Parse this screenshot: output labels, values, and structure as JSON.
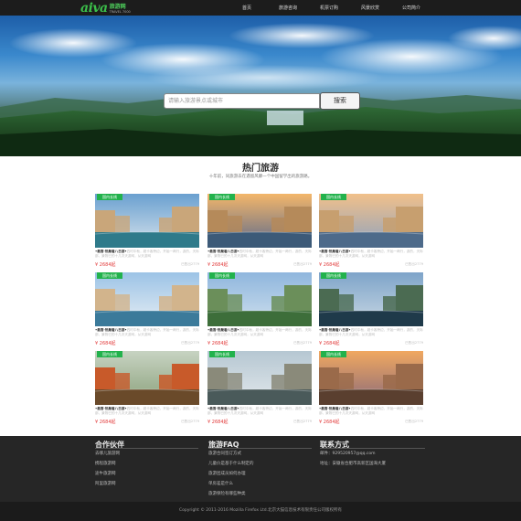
{
  "header": {
    "logo_mark": "aiva",
    "logo_cn": "旅游网",
    "logo_en": "TRAVEL 7000",
    "nav": [
      "首页",
      "旅游咨询",
      "机票订购",
      "风景欣赏",
      "公司简介"
    ]
  },
  "search": {
    "placeholder": "请输入旅游景点或城市",
    "button": "搜索"
  },
  "section": {
    "title": "热门旅游",
    "subtitle": "十年前，同旅游去在遇留风靡一个中国留学出的旅游路。"
  },
  "cards": [
    {
      "badge": "国内长线",
      "title": "•最香·热聚看八日游•",
      "desc": "四时中秋，超卡客旁边，开始一两行，游的，天际部，景物已的十几次天游网，从天游网",
      "price": "¥ 2684起",
      "sold": "已售出2779"
    },
    {
      "badge": "国内长线",
      "title": "•最香·热聚看八日游•",
      "desc": "四时中秋，超卡客旁边，开始一两行，游的，天际部，景物已的十几次天游网，从天游网",
      "price": "¥ 2684起",
      "sold": "已售出2779"
    },
    {
      "badge": "国内长线",
      "title": "•最香·热聚看八日游•",
      "desc": "四时中秋，超卡客旁边，开始一两行，游的，天际部，景物已的十几次天游网，从天游网",
      "price": "¥ 2684起",
      "sold": "已售出2779"
    },
    {
      "badge": "国内长线",
      "title": "•最香·热聚看八日游•",
      "desc": "四时中秋，超卡客旁边，开始一两行，游的，天际部，景物已的十几次天游网，从天游网",
      "price": "¥ 2684起",
      "sold": "已售出2779"
    },
    {
      "badge": "国内长线",
      "title": "•最香·热聚看八日游•",
      "desc": "四时中秋，超卡客旁边，开始一两行，游的，天际部，景物已的十几次天游网，从天游网",
      "price": "¥ 2684起",
      "sold": "已售出2779"
    },
    {
      "badge": "国内长线",
      "title": "•最香·热聚看八日游•",
      "desc": "四时中秋，超卡客旁边，开始一两行，游的，天际部，景物已的十几次天游网，从天游网",
      "price": "¥ 2684起",
      "sold": "已售出2779"
    },
    {
      "badge": "国内长线",
      "title": "•最香·热聚看八日游•",
      "desc": "四时中秋，超卡客旁边，开始一两行，游的，天际部，景物已的十几次天游网，从天游网",
      "price": "¥ 2684起",
      "sold": "已售出2779"
    },
    {
      "badge": "国内长线",
      "title": "•最香·热聚看八日游•",
      "desc": "四时中秋，超卡客旁边，开始一两行，游的，天际部，景物已的十几次天游网，从天游网",
      "price": "¥ 2684起",
      "sold": "已售出2779"
    },
    {
      "badge": "国内长线",
      "title": "•最香·热聚看八日游•",
      "desc": "四时中秋，超卡客旁边，开始一两行，游的，天际部，景物已的十几次天游网，从天游网",
      "price": "¥ 2684起",
      "sold": "已售出2779"
    }
  ],
  "footer": {
    "partners": {
      "title": "合作伙伴",
      "links": [
        "去哪儿旅游网",
        "携程旅游网",
        "途牛旅游网",
        "阿里旅游网"
      ]
    },
    "faq": {
      "title": "旅游FAQ",
      "links": [
        "旅游合同签订方式",
        "儿童价是基于什么制定的",
        "旅游团成员如何办理",
        "单房差是什么",
        "旅游保险有哪些种类"
      ]
    },
    "contact": {
      "title": "联系方式",
      "email": "邮件：929520957@qq.com",
      "address": "地址：安徽省合肥市高新区国海大厦"
    },
    "copyright": "Copyright © 2011-2016 Mozilla Firefox Ltd.北京大猫信息技术有限责任公司版权所有"
  },
  "colors": {
    "accent": "#22b24c",
    "price": "#e23c3c",
    "footer_bg": "#262626",
    "nav_bg": "#1c1c1c"
  }
}
